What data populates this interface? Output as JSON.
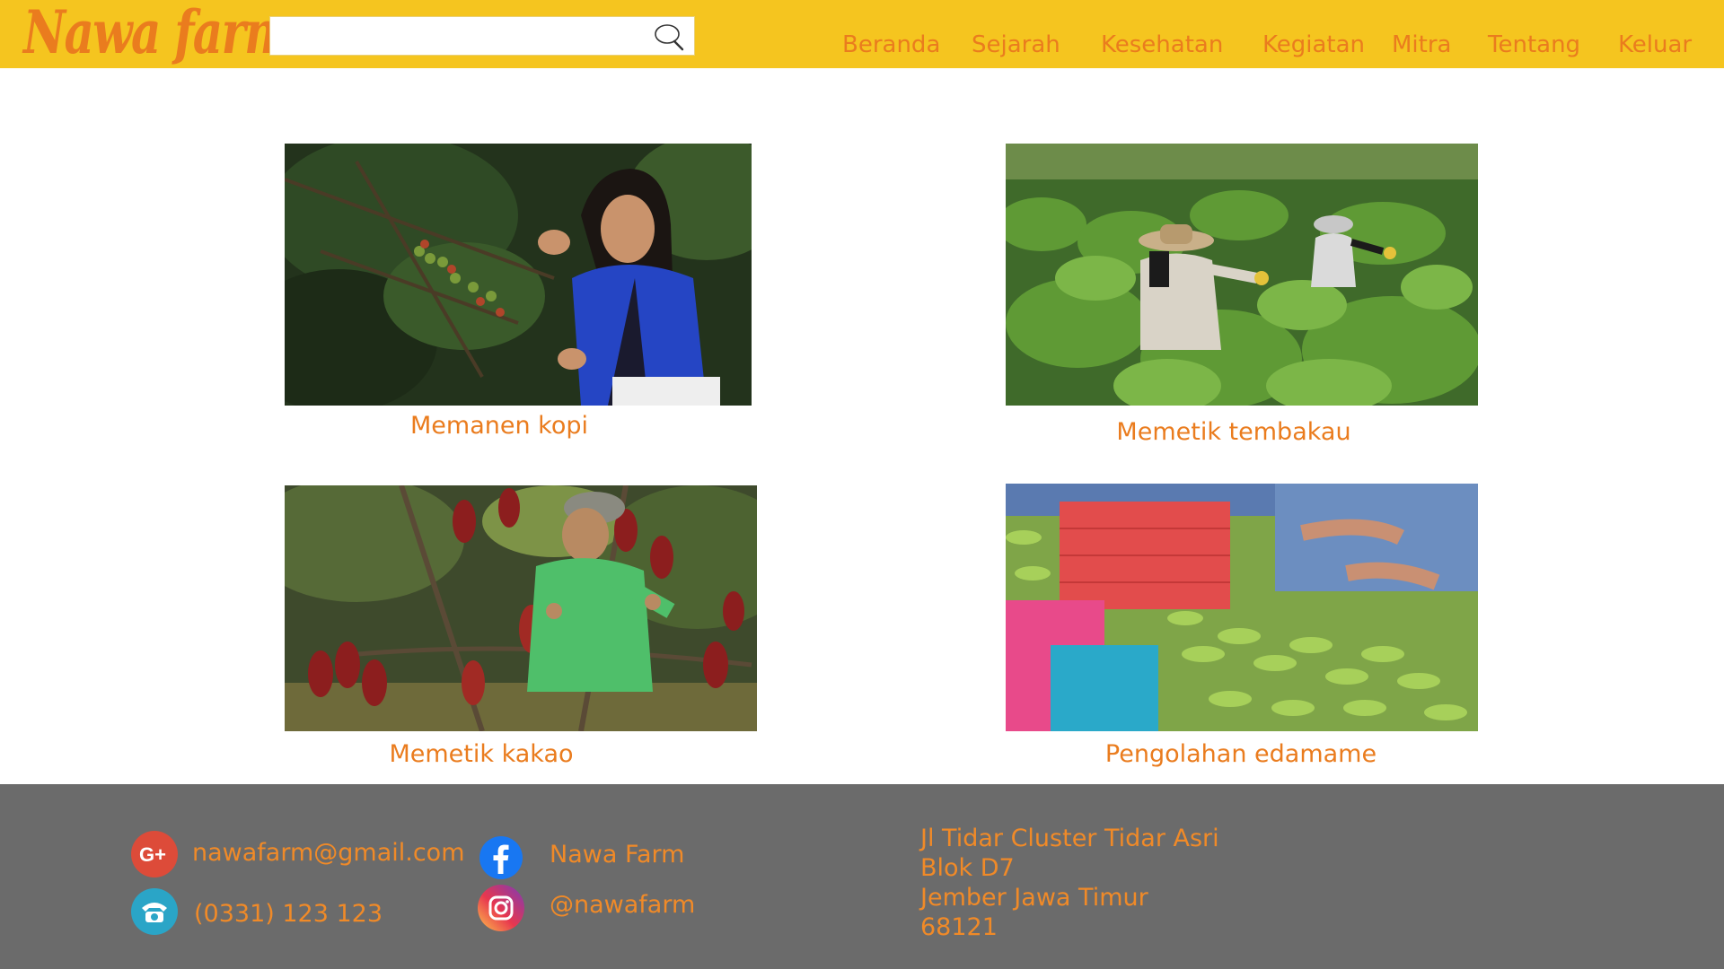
{
  "brand": {
    "logo_text": "Nawa farm"
  },
  "search": {
    "value": "",
    "placeholder": ""
  },
  "nav": {
    "beranda": "Beranda",
    "sejarah": "Sejarah",
    "kesehatan": "Kesehatan",
    "kegiatan": "Kegiatan",
    "mitra": "Mitra",
    "tentang": "Tentang",
    "keluar": "Keluar"
  },
  "gallery": {
    "items": [
      {
        "caption": "Memanen kopi",
        "image": "coffee-harvest-photo"
      },
      {
        "caption": "Memetik tembakau",
        "image": "tobacco-picking-photo"
      },
      {
        "caption": "Memetik kakao",
        "image": "cocoa-picking-photo"
      },
      {
        "caption": "Pengolahan edamame",
        "image": "edamame-processing-photo"
      }
    ]
  },
  "footer": {
    "email": "nawafarm@gmail.com",
    "phone": "(0331) 123 123",
    "facebook": "Nawa Farm",
    "instagram": "@nawafarm",
    "address": [
      "Jl Tidar Cluster Tidar Asri",
      "Blok D7",
      "Jember Jawa Timur",
      "68121"
    ]
  },
  "colors": {
    "header_bg": "#f5c51f",
    "accent_orange": "#ea7c1e",
    "footer_bg": "#6b6b6b"
  }
}
